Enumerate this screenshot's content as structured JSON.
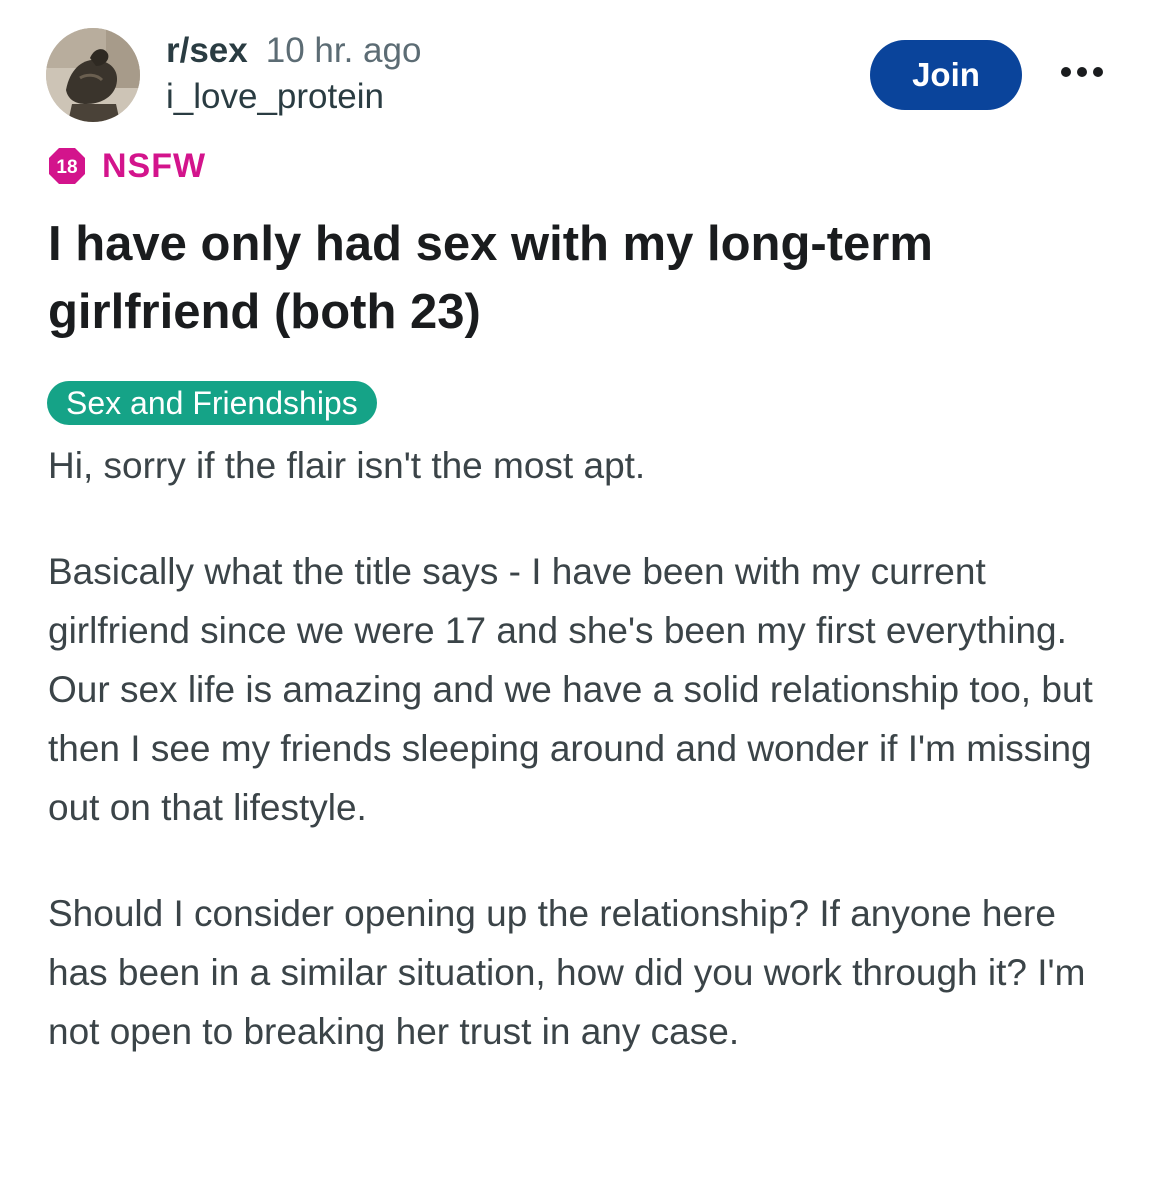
{
  "header": {
    "subreddit": "r/sex",
    "time_ago": "10 hr. ago",
    "username": "i_love_protein",
    "join_label": "Join",
    "more_icon": "ellipsis-icon"
  },
  "nsfw": {
    "age_badge": "18",
    "label": "NSFW",
    "color": "#d3148c"
  },
  "post": {
    "title": "I have only had sex with my long-term girlfriend (both 23)",
    "flair": "Sex and Friendships",
    "flair_color": "#15a387",
    "paragraphs": [
      "Hi, sorry if the flair isn't the most apt.",
      "Basically what the title says - I have been with my current girlfriend since we were 17 and she's been my first everything. Our sex life is amazing and we have a solid relationship too, but then I see my friends sleeping around and wonder if I'm missing out on that lifestyle.",
      "Should I consider opening up the relationship? If anyone here has been in a similar situation, how did you work through it? I'm not open to breaking her trust in any case."
    ]
  },
  "colors": {
    "join_button": "#0a449b"
  }
}
